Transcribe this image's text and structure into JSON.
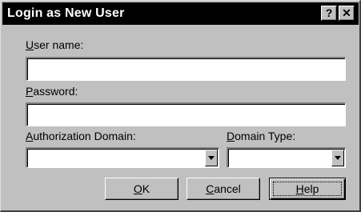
{
  "window": {
    "title": "Login as New User",
    "help_button": "?",
    "close_button": "✕"
  },
  "form": {
    "username": {
      "label_accel": "U",
      "label_rest": "ser name:",
      "value": ""
    },
    "password": {
      "label_accel": "P",
      "label_rest": "assword:",
      "value": ""
    },
    "auth_domain": {
      "label_accel": "A",
      "label_rest": "uthorization Domain:",
      "value": ""
    },
    "domain_type": {
      "label_accel": "D",
      "label_rest": "omain Type:",
      "value": ""
    }
  },
  "buttons": {
    "ok": {
      "accel": "O",
      "rest": "K"
    },
    "cancel": {
      "accel": "C",
      "rest": "ancel"
    },
    "help": {
      "accel": "H",
      "rest": "elp"
    }
  }
}
